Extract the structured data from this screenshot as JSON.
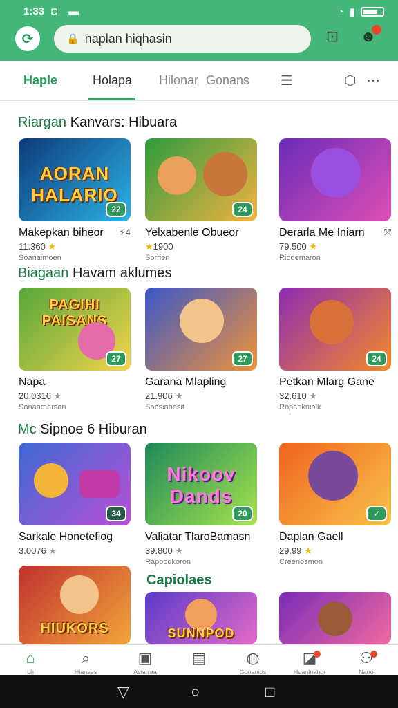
{
  "status": {
    "time": "1:33",
    "icons": "◘ ▬"
  },
  "search": {
    "value": "naplan hiqhasin"
  },
  "tabs": [
    {
      "label": "Haple"
    },
    {
      "label": "Holapa"
    },
    {
      "label": "Hilonar"
    },
    {
      "label": "Gonans"
    }
  ],
  "sections": [
    {
      "title_accent": "Riargan",
      "title_rest": "Kanvars: Hibuara",
      "cards": [
        {
          "logo": "AORAN HALARIO",
          "badge": "22",
          "title": "Makepkan biheor",
          "side": "⚡4",
          "rating": "11.360",
          "star": "★",
          "sub": "Soanaimoen",
          "colors": [
            "#0e3a7a",
            "#2bb3e6"
          ]
        },
        {
          "logo": "",
          "badge": "24",
          "title": "Yelxabenle Obueor",
          "side": "",
          "rating": "1900",
          "star": "★",
          "sub": "Sorrien",
          "colors": [
            "#2e9b3e",
            "#f2b441"
          ]
        },
        {
          "logo": "",
          "badge": "",
          "title": "Derarla Me Iniarn",
          "side": "⤱",
          "rating": "79.500",
          "star": "★",
          "sub": "Riodemaron",
          "colors": [
            "#6a2bb8",
            "#e04fb6"
          ]
        }
      ]
    },
    {
      "title_accent": "Biagaan",
      "title_rest": "Havam aklumes",
      "cards": [
        {
          "logo": "PAGIHI PAISANS",
          "badge": "27",
          "title": "Napa",
          "side": "",
          "rating": "20.0316",
          "star": "★",
          "sub": "Sonaamarsan",
          "colors": [
            "#55a83a",
            "#f4d34a"
          ]
        },
        {
          "logo": "",
          "badge": "27",
          "title": "Garana Mlapling",
          "side": "",
          "rating": "21.906",
          "star": "★",
          "sub": "Sobsinbosit",
          "colors": [
            "#3a58c8",
            "#f0923a"
          ]
        },
        {
          "logo": "",
          "badge": "24",
          "title": "Petkan Mlarg Gane",
          "side": "",
          "rating": "32.610",
          "star": "★",
          "sub": "Ropanknialk",
          "colors": [
            "#8d2bb3",
            "#f58a2a"
          ]
        }
      ]
    },
    {
      "title_accent": "Mc",
      "title_rest": "Sipnoe 6 Hiburan",
      "cards": [
        {
          "logo": "",
          "badge": "34",
          "title": "Sarkale Honetefiog",
          "side": "",
          "rating": "3.0076",
          "star": "★",
          "sub": "",
          "colors": [
            "#3f6ad4",
            "#b84fd6"
          ]
        },
        {
          "logo": "Nikoov Dands",
          "badge": "20",
          "title": "Valiatar TlaroBamasn",
          "side": "",
          "rating": "39.800",
          "star": "★",
          "sub": "Rapbodkoron",
          "colors": [
            "#1e8a5a",
            "#a6e34d"
          ]
        },
        {
          "logo": "",
          "badge": "✓",
          "title": "Daplan Gaell",
          "side": "",
          "rating": "29.99",
          "star": "★",
          "sub": "Creenosmon",
          "colors": [
            "#f0641e",
            "#f8c34a"
          ]
        }
      ]
    }
  ],
  "fourth": {
    "title": "Capiolaes",
    "cards": [
      {
        "logo": "HIUKORS",
        "colors": [
          "#c0312e",
          "#f2a53a"
        ]
      },
      {
        "logo": "SUNNPOD",
        "colors": [
          "#5a3bc8",
          "#e46ac8"
        ]
      },
      {
        "logo": "",
        "colors": [
          "#7a2bb8",
          "#f06aa0"
        ]
      }
    ]
  },
  "bottom_nav": [
    {
      "icon": "⌂",
      "label": "Lh"
    },
    {
      "icon": "⌕",
      "label": "Hlanses"
    },
    {
      "icon": "▣",
      "label": "Aciarraa"
    },
    {
      "icon": "▤",
      "label": ""
    },
    {
      "icon": "◍",
      "label": "Gonanios"
    },
    {
      "icon": "◪",
      "label": "Hoanlnahor"
    },
    {
      "icon": "⚇",
      "label": "Nano"
    }
  ],
  "colors": {
    "brand": "#46b77a",
    "accent": "#2ea765"
  }
}
